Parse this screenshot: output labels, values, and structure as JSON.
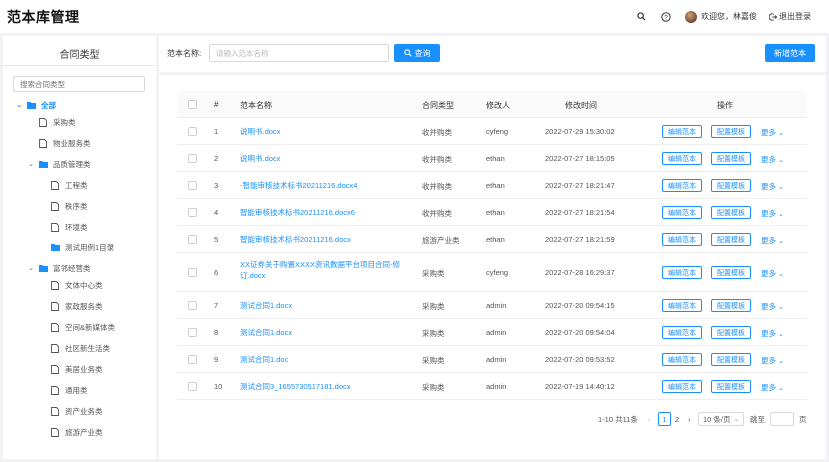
{
  "header": {
    "title": "范本库管理",
    "welcome": "欢迎您，林嘉俊",
    "logout": "退出登录"
  },
  "sidebar": {
    "title": "合同类型",
    "search_placeholder": "搜索合同类型",
    "items": [
      {
        "label": "全部"
      },
      {
        "label": "采购类"
      },
      {
        "label": "物业服务类"
      },
      {
        "label": "品质管理类"
      },
      {
        "label": "工程类"
      },
      {
        "label": "秩序类"
      },
      {
        "label": "环境类"
      },
      {
        "label": "测试用例1目录"
      },
      {
        "label": "富邻经营类"
      },
      {
        "label": "文体中心类"
      },
      {
        "label": "家政服务类"
      },
      {
        "label": "空间&新媒体类"
      },
      {
        "label": "社区新生活类"
      },
      {
        "label": "美居业务类"
      },
      {
        "label": "通用类"
      },
      {
        "label": "资产业务类"
      },
      {
        "label": "旅游产业类"
      }
    ]
  },
  "search": {
    "label": "范本名称:",
    "placeholder": "请输入范本名称",
    "query_label": "查询",
    "add_label": "新增范本"
  },
  "table": {
    "headers": {
      "index": "#",
      "name": "范本名称",
      "type": "合同类型",
      "editor": "修改人",
      "time": "修改时间",
      "ops": "操作"
    },
    "edit_label": "编辑范本",
    "config_label": "配置模板",
    "more_label": "更多",
    "rows": [
      {
        "index": "1",
        "name": "说明书.docx",
        "type": "收并购类",
        "editor": "cyfeng",
        "time": "2022-07-29 15:30:02"
      },
      {
        "index": "2",
        "name": "说明书.docx",
        "type": "收并购类",
        "editor": "ethan",
        "time": "2022-07-27 18:15:05"
      },
      {
        "index": "3",
        "name": "-智能审核技术标书20211216.docx4",
        "type": "收并购类",
        "editor": "ethan",
        "time": "2022-07-27 18:21:47"
      },
      {
        "index": "4",
        "name": "智能审核技术标书20211216.docx6",
        "type": "收并购类",
        "editor": "ethan",
        "time": "2022-07-27 18:21:54"
      },
      {
        "index": "5",
        "name": "智能审核技术标书20211216.docx",
        "type": "旅游产业类",
        "editor": "ethan",
        "time": "2022-07-27 18:21:59"
      },
      {
        "index": "6",
        "name": "XX证券关于购置XXXX资讯数据平台项目合同-修订.docx",
        "type": "采购类",
        "editor": "cyfeng",
        "time": "2022-07-28 16:29:37"
      },
      {
        "index": "7",
        "name": "测试合同1.docx",
        "type": "采购类",
        "editor": "admin",
        "time": "2022-07-20 09:54:15"
      },
      {
        "index": "8",
        "name": "测试合同1.docx",
        "type": "采购类",
        "editor": "admin",
        "time": "2022-07-20 09:54:04"
      },
      {
        "index": "9",
        "name": "测试合同1.doc",
        "type": "采购类",
        "editor": "admin",
        "time": "2022-07-20 09:53:52"
      },
      {
        "index": "10",
        "name": "测试合同3_1655730517181.docx",
        "type": "采购类",
        "editor": "admin",
        "time": "2022-07-19 14:40:12"
      }
    ]
  },
  "pagination": {
    "summary": "1-10 共11条",
    "pages": [
      "1",
      "2"
    ],
    "current": "1",
    "page_size": "10 条/页",
    "jump_label": "跳至",
    "page_suffix": "页"
  },
  "colors": {
    "accent": "#1890ff"
  }
}
